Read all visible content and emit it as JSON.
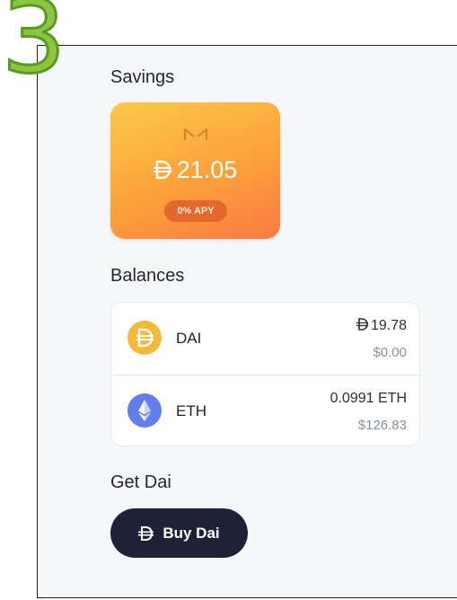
{
  "step": {
    "number": "3"
  },
  "savings": {
    "title": "Savings",
    "amount": "21.05",
    "apy_badge": "0% APY",
    "icon": "maker-logo-icon"
  },
  "balances": {
    "title": "Balances",
    "rows": [
      {
        "token": "DAI",
        "amount": "19.78",
        "usd": "$0.00",
        "icon": "dai-icon"
      },
      {
        "token": "ETH",
        "amount": "0.0991 ETH",
        "usd": "$126.83",
        "icon": "eth-icon"
      }
    ]
  },
  "get_dai": {
    "title": "Get Dai",
    "button_label": "Buy Dai"
  },
  "colors": {
    "step_number": "#8cc63f",
    "card_gradient_start": "#fbc94a",
    "card_gradient_end": "#fb7a44",
    "apy_badge": "#e2692b",
    "dai": "#f6b83b",
    "eth": "#627eea",
    "button": "#1f2237"
  }
}
